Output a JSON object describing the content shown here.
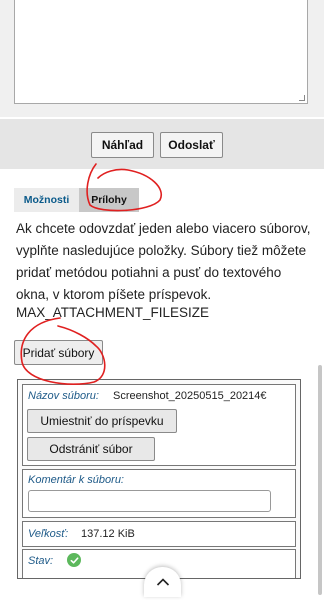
{
  "form": {
    "preview_label": "Náhľad",
    "submit_label": "Odoslať"
  },
  "tabs": [
    {
      "label": "Možnosti"
    },
    {
      "label": "Prílohy"
    }
  ],
  "attachments": {
    "info": "Ak chcete odovzdať jeden alebo viacero súborov, vyplňte nasledujúce položky. Súbory tiež môžete pridať metódou potiahni a pusť do textového okna, v ktorom píšete príspevok.",
    "max_size_label": "MAX_ATTACHMENT_FILESIZE",
    "add_files_label": "Pridať súbory",
    "file": {
      "name_label": "Názov súboru:",
      "name_value": "Screenshot_20250515_20214€",
      "insert_label": "Umiestniť do príspevku",
      "remove_label": "Odstrániť súbor",
      "comment_label": "Komentár k súboru:",
      "comment_value": "",
      "size_label": "Veľkosť:",
      "size_value": "137.12 KiB",
      "state_label": "Stav:",
      "state_icon": "check-circle-icon",
      "state_color": "#5cb85c"
    }
  },
  "annotation_color": "#e02020"
}
